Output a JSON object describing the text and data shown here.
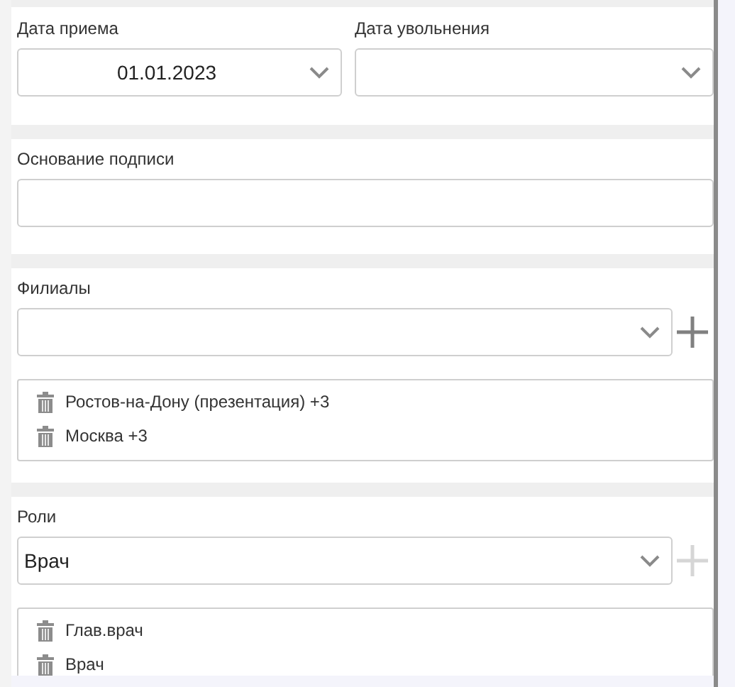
{
  "hire_date": {
    "label": "Дата приема",
    "value": "01.01.2023"
  },
  "dismissal_date": {
    "label": "Дата увольнения"
  },
  "signature_basis": {
    "label": "Основание подписи"
  },
  "branches": {
    "label": "Филиалы",
    "add_disabled": false,
    "items": [
      {
        "text": "Ростов-на-Дону (презентация) +3"
      },
      {
        "text": "Москва +3"
      }
    ]
  },
  "roles": {
    "label": "Роли",
    "value": "Врач",
    "add_disabled": true,
    "items": [
      {
        "text": "Глав.врач"
      },
      {
        "text": "Врач"
      }
    ]
  }
}
